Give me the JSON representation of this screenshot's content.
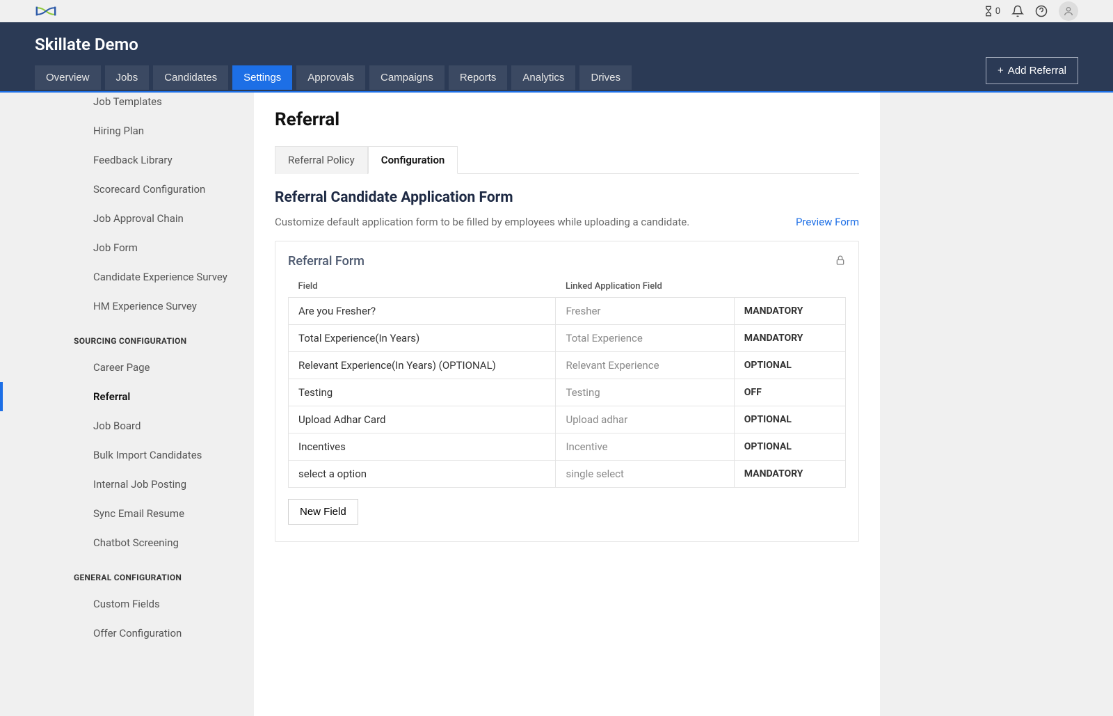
{
  "topbar": {
    "badge_count": "0"
  },
  "header": {
    "brand": "Skillate Demo",
    "add_button": "Add Referral",
    "tabs": [
      "Overview",
      "Jobs",
      "Candidates",
      "Settings",
      "Approvals",
      "Campaigns",
      "Reports",
      "Analytics",
      "Drives"
    ],
    "active_tab": "Settings"
  },
  "sidebar": {
    "items_top": [
      "Job Templates",
      "Hiring Plan",
      "Feedback Library",
      "Scorecard Configuration",
      "Job Approval Chain",
      "Job Form",
      "Candidate Experience Survey",
      "HM Experience Survey"
    ],
    "section_sourcing": "SOURCING CONFIGURATION",
    "items_sourcing": [
      "Career Page",
      "Referral",
      "Job Board",
      "Bulk Import Candidates",
      "Internal Job Posting",
      "Sync Email Resume",
      "Chatbot Screening"
    ],
    "active_sourcing": "Referral",
    "section_general": "GENERAL CONFIGURATION",
    "items_general": [
      "Custom Fields",
      "Offer Configuration"
    ]
  },
  "content": {
    "title": "Referral",
    "subtabs": {
      "policy": "Referral Policy",
      "config": "Configuration"
    },
    "heading": "Referral Candidate Application Form",
    "description": "Customize default application form to be filled by employees while uploading a candidate.",
    "preview": "Preview Form",
    "form_title": "Referral Form",
    "columns": {
      "field": "Field",
      "linked": "Linked Application Field"
    },
    "rows": [
      {
        "field": "Are you Fresher?",
        "linked": "Fresher",
        "status": "MANDATORY"
      },
      {
        "field": "Total Experience(In Years)",
        "linked": "Total Experience",
        "status": "MANDATORY"
      },
      {
        "field": "Relevant Experience(In Years) (OPTIONAL)",
        "linked": "Relevant Experience",
        "status": "OPTIONAL"
      },
      {
        "field": "Testing",
        "linked": "Testing",
        "status": "OFF"
      },
      {
        "field": "Upload Adhar Card",
        "linked": "Upload adhar",
        "status": "OPTIONAL"
      },
      {
        "field": "Incentives",
        "linked": "Incentive",
        "status": "OPTIONAL"
      },
      {
        "field": "select a option",
        "linked": "single select",
        "status": "MANDATORY"
      }
    ],
    "new_field": "New Field"
  }
}
